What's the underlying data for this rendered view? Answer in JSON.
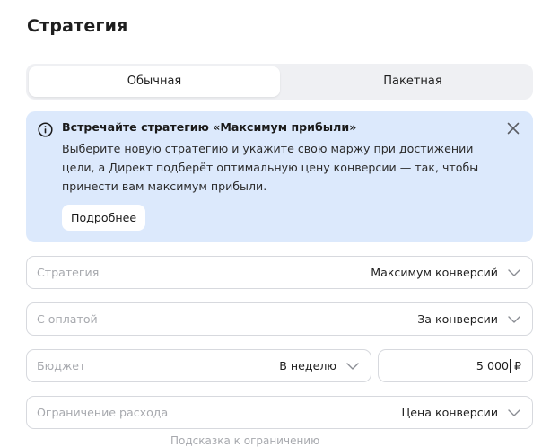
{
  "header": {
    "title": "Стратегия"
  },
  "tabs": [
    {
      "label": "Обычная",
      "active": true
    },
    {
      "label": "Пакетная",
      "active": false
    }
  ],
  "banner": {
    "icon": "info-icon",
    "title": "Встречайте стратегию «Максимум прибыли»",
    "text": "Выберите новую стратегию и укажите свою маржу при достижении цели, а Директ подберёт оптимальную цену конверсии — так, чтобы принести вам максимум прибыли.",
    "more_label": "Подробнее",
    "background_color": "#dce9fc"
  },
  "fields": {
    "strategy": {
      "label": "Стратегия",
      "value": "Максимум конверсий"
    },
    "payment": {
      "label": "С оплатой",
      "value": "За конверсии"
    },
    "budget": {
      "label": "Бюджет",
      "period": "В неделю",
      "amount": "5 000",
      "currency": "₽"
    },
    "limit": {
      "label": "Ограничение расхода",
      "value": "Цена конверсии"
    }
  },
  "footer": {
    "cutoff_text": "Подсказка к ограничению"
  }
}
